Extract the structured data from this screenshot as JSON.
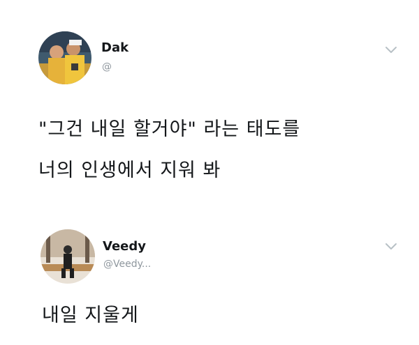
{
  "tweets": [
    {
      "author": {
        "name": "Dak",
        "handle": "@"
      },
      "text_lines": [
        "\"그건 내일 할거야\" 라는 태도를",
        "너의 인생에서 지워 봐"
      ]
    },
    {
      "author": {
        "name": "Veedy",
        "handle": "@Veedy..."
      },
      "text_lines": [
        "내일 지울게"
      ]
    }
  ],
  "icons": {
    "avatar": "avatar-photo",
    "menu": "chevron-down-icon"
  },
  "colors": {
    "text": "#14171a",
    "handle": "#8f979e",
    "chevron": "#b8c0c6"
  }
}
